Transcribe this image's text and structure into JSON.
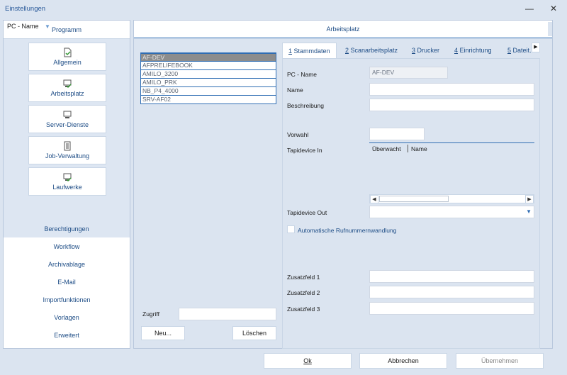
{
  "window": {
    "title": "Einstellungen",
    "minimize": "—",
    "close": "✕"
  },
  "nav": {
    "header": "Programm",
    "tiles": [
      {
        "label": "Allgemein",
        "icon": "document-check-icon"
      },
      {
        "label": "Arbeitsplatz",
        "icon": "computer-check-icon"
      },
      {
        "label": "Server-Dienste",
        "icon": "monitor-icon"
      },
      {
        "label": "Job-Verwaltung",
        "icon": "document-list-icon"
      },
      {
        "label": "Laufwerke",
        "icon": "computer-check-icon"
      }
    ],
    "links": [
      "Berechtigungen",
      "Workflow",
      "Archivablage",
      "E-Mail",
      "Importfunktionen",
      "Vorlagen",
      "Erweitert"
    ]
  },
  "main": {
    "header": "Arbeitsplatz",
    "pc_list": {
      "column": "PC - Name",
      "rows": [
        "AF-DEV",
        "AFPRELIFEBOOK",
        "AMILO_3200",
        "AMILO_PRK",
        "NB_P4_4000",
        "SRV-AF02"
      ],
      "selected": 0
    },
    "zugriff_label": "Zugriff",
    "zugriff_value": "",
    "new_button": "Neu...",
    "delete_button": "Löschen",
    "tabs": [
      {
        "num": "1",
        "label": " Stammdaten"
      },
      {
        "num": "2",
        "label": " Scanarbeitsplatz"
      },
      {
        "num": "3",
        "label": " Drucker"
      },
      {
        "num": "4",
        "label": " Einrichtung"
      },
      {
        "num": "5",
        "label": " Dateit..."
      }
    ],
    "form": {
      "pc_name_label": "PC - Name",
      "pc_name_value": "AF-DEV",
      "name_label": "Name",
      "name_value": "",
      "beschreibung_label": "Beschreibung",
      "beschreibung_value": "",
      "vorwahl_label": "Vorwahl",
      "vorwahl_value": "",
      "tapi_in_label": "Tapidevice In",
      "tapi_cols": [
        "Überwacht",
        "Name"
      ],
      "tapi_out_label": "Tapidevice Out",
      "tapi_out_value": "",
      "auto_label": "Automatische Rufnummernwandlung",
      "zusatz1_label": "Zusatzfeld 1",
      "zusatz2_label": "Zusatzfeld 2",
      "zusatz3_label": "Zusatzfeld 3"
    }
  },
  "footer": {
    "ok": "Ok",
    "cancel": "Abbrechen",
    "apply": "Übernehmen"
  },
  "colors": {
    "accent": "#2f6db3",
    "link": "#1e4d86",
    "background": "#dbe4f0"
  }
}
